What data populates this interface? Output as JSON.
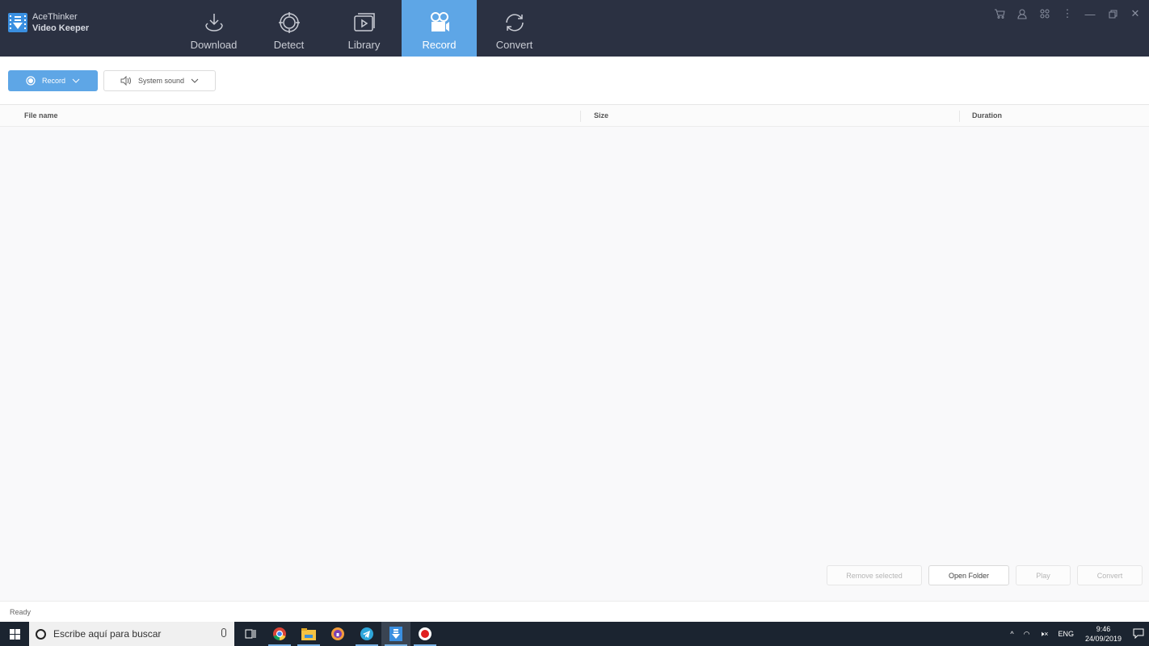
{
  "app": {
    "brand_line1": "AceThinker",
    "brand_line2": "Video Keeper",
    "accent_color": "#5ea6e6",
    "topbar_color": "#2b3142"
  },
  "nav": [
    {
      "label": "Download",
      "icon": "download-icon",
      "active": false
    },
    {
      "label": "Detect",
      "icon": "detect-icon",
      "active": false
    },
    {
      "label": "Library",
      "icon": "library-icon",
      "active": false
    },
    {
      "label": "Record",
      "icon": "camera-icon",
      "active": true
    },
    {
      "label": "Convert",
      "icon": "convert-icon",
      "active": false
    }
  ],
  "window_controls": [
    "cart-icon",
    "user-icon",
    "apps-icon",
    "more-icon",
    "minimize-icon",
    "restore-icon",
    "close-icon"
  ],
  "toolbar": {
    "record_label": "Record",
    "sound_label": "System sound"
  },
  "table": {
    "columns": [
      "File name",
      "Size",
      "Duration"
    ],
    "rows": []
  },
  "actions": {
    "remove_selected": "Remove selected",
    "open_folder": "Open Folder",
    "play": "Play",
    "convert": "Convert"
  },
  "status": "Ready",
  "taskbar": {
    "search_placeholder": "Escribe aquí para buscar",
    "apps": [
      "task-view-icon",
      "chrome-icon",
      "file-explorer-icon",
      "vpn-browser-icon",
      "telegram-icon",
      "video-keeper-icon",
      "recorder-icon"
    ],
    "language": "ENG",
    "time": "9:46",
    "date": "24/09/2019"
  }
}
